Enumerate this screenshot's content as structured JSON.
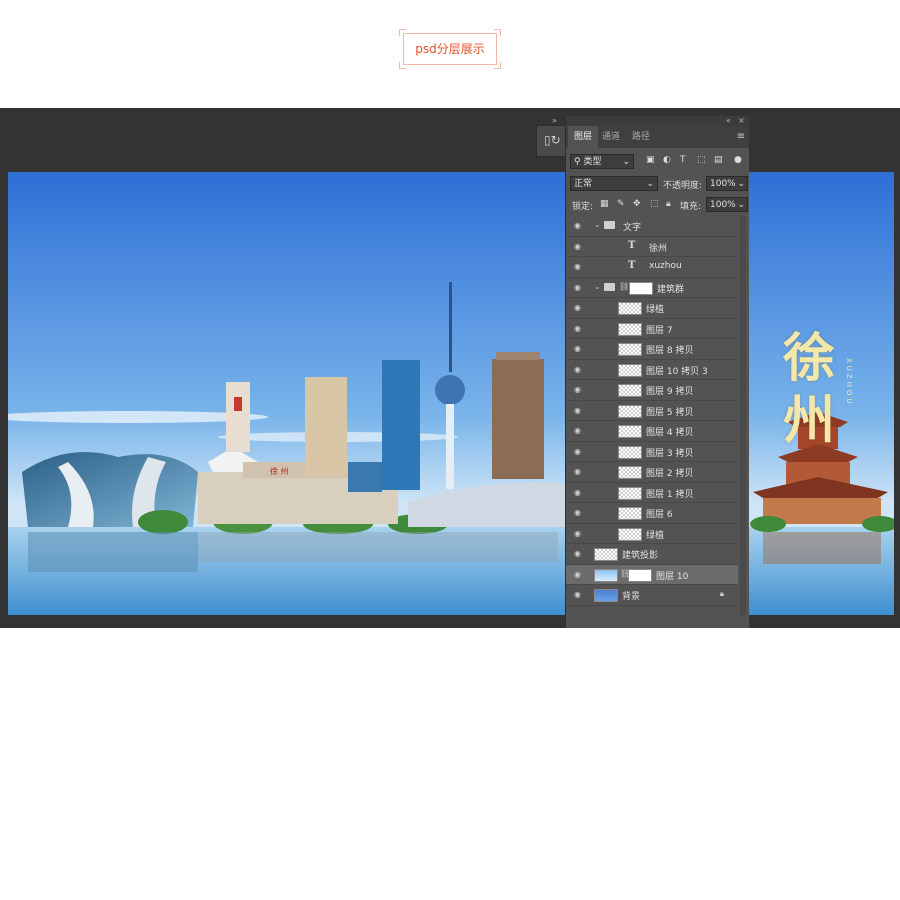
{
  "header": {
    "tag_label": "psd分层展示"
  },
  "artwork": {
    "title_cn": "徐州",
    "title_pinyin": "XUZHOU",
    "sign_text": "徐 州"
  },
  "panel": {
    "tabs": [
      "图层",
      "通道",
      "路径"
    ],
    "filter_label": "类型",
    "blend_mode": "正常",
    "opacity_label": "不透明度:",
    "opacity_value": "100%",
    "lock_label": "锁定:",
    "fill_label": "填充:",
    "fill_value": "100%",
    "layers": [
      {
        "name": "文字",
        "kind": "group",
        "indent": 0,
        "expanded": true
      },
      {
        "name": "徐州",
        "kind": "text",
        "indent": 1
      },
      {
        "name": "xuzhou",
        "kind": "text",
        "indent": 1
      },
      {
        "name": "建筑群",
        "kind": "group-mask",
        "indent": 0,
        "expanded": true
      },
      {
        "name": "绿植",
        "kind": "layer",
        "indent": 1
      },
      {
        "name": "图层 7",
        "kind": "layer",
        "indent": 1
      },
      {
        "name": "图层 8 拷贝",
        "kind": "layer",
        "indent": 1
      },
      {
        "name": "图层 10 拷贝 3",
        "kind": "layer",
        "indent": 1
      },
      {
        "name": "图层 9 拷贝",
        "kind": "layer",
        "indent": 1
      },
      {
        "name": "图层 5 拷贝",
        "kind": "layer",
        "indent": 1
      },
      {
        "name": "图层 4 拷贝",
        "kind": "layer",
        "indent": 1
      },
      {
        "name": "图层 3 拷贝",
        "kind": "layer",
        "indent": 1
      },
      {
        "name": "图层 2 拷贝",
        "kind": "layer",
        "indent": 1
      },
      {
        "name": "图层 1 拷贝",
        "kind": "layer",
        "indent": 1
      },
      {
        "name": "图层 6",
        "kind": "layer",
        "indent": 1
      },
      {
        "name": "绿植",
        "kind": "layer",
        "indent": 1
      },
      {
        "name": "建筑投影",
        "kind": "layer",
        "indent": 0
      },
      {
        "name": "图层 10",
        "kind": "layer-mask",
        "indent": 0,
        "selected": true
      },
      {
        "name": "背景",
        "kind": "background",
        "indent": 0,
        "locked": true
      }
    ]
  }
}
